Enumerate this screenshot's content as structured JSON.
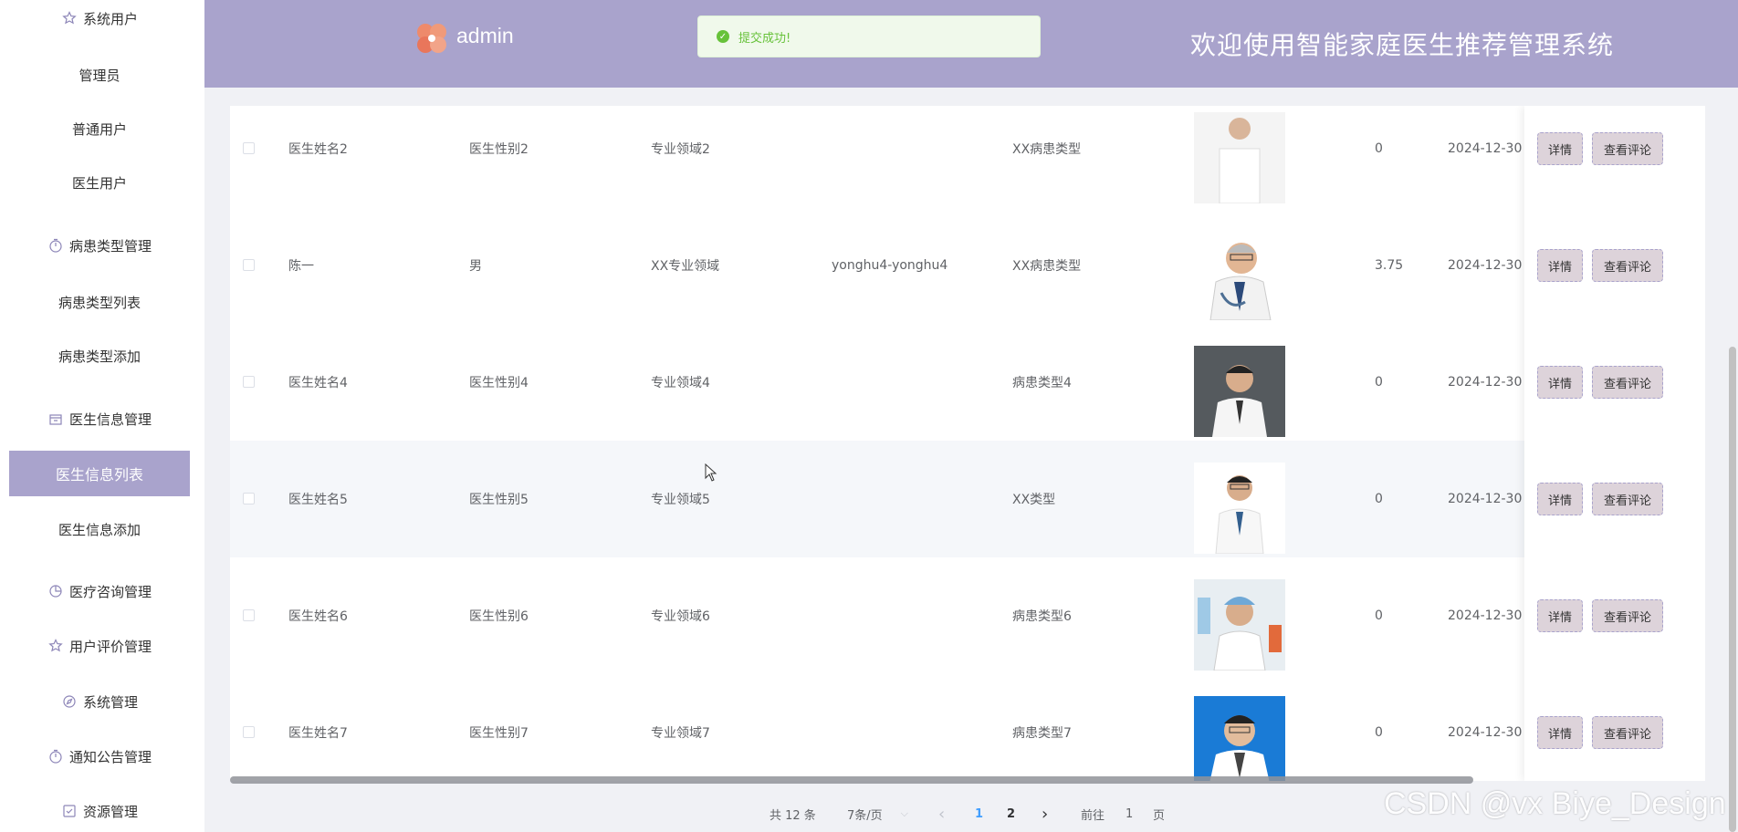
{
  "header": {
    "brand": "admin",
    "title": "欢迎使用智能家庭医生推荐管理系统",
    "toast": "提交成功!"
  },
  "sidebar": {
    "items": [
      {
        "label": "系统用户",
        "icon": "star-icon"
      },
      {
        "label": "管理员"
      },
      {
        "label": "普通用户"
      },
      {
        "label": "医生用户"
      },
      {
        "label": "病患类型管理",
        "icon": "timer-icon"
      },
      {
        "label": "病患类型列表"
      },
      {
        "label": "病患类型添加"
      },
      {
        "label": "医生信息管理",
        "icon": "box-icon"
      },
      {
        "label": "医生信息列表"
      },
      {
        "label": "医生信息添加"
      },
      {
        "label": "医疗咨询管理",
        "icon": "pie-icon"
      },
      {
        "label": "用户评价管理",
        "icon": "star-icon"
      },
      {
        "label": "系统管理",
        "icon": "compass-icon"
      },
      {
        "label": "通知公告管理",
        "icon": "timer-icon"
      },
      {
        "label": "资源管理",
        "icon": "check-icon"
      }
    ],
    "active_index": 8
  },
  "table": {
    "rows": [
      {
        "name": "医生姓名2",
        "gender": "医生性别2",
        "field": "专业领域2",
        "account": "",
        "disease": "XX病患类型",
        "score": "0",
        "date": "2024-12-30"
      },
      {
        "name": "陈一",
        "gender": "男",
        "field": "XX专业领域",
        "account": "yonghu4-yonghu4",
        "disease": "XX病患类型",
        "score": "3.75",
        "date": "2024-12-30"
      },
      {
        "name": "医生姓名4",
        "gender": "医生性别4",
        "field": "专业领域4",
        "account": "",
        "disease": "病患类型4",
        "score": "0",
        "date": "2024-12-30"
      },
      {
        "name": "医生姓名5",
        "gender": "医生性别5",
        "field": "专业领域5",
        "account": "",
        "disease": "XX类型",
        "score": "0",
        "date": "2024-12-30"
      },
      {
        "name": "医生姓名6",
        "gender": "医生性别6",
        "field": "专业领域6",
        "account": "",
        "disease": "病患类型6",
        "score": "0",
        "date": "2024-12-30"
      },
      {
        "name": "医生姓名7",
        "gender": "医生性别7",
        "field": "专业领域7",
        "account": "",
        "disease": "病患类型7",
        "score": "0",
        "date": "2024-12-30"
      }
    ],
    "detail_label": "详情",
    "comment_label": "查看评论"
  },
  "pagination": {
    "total": "共 12 条",
    "page_size": "7条/页",
    "pages": [
      "1",
      "2"
    ],
    "current": "1",
    "goto_prefix": "前往",
    "goto_value": "1",
    "goto_suffix": "页"
  },
  "watermark": "CSDN @vx Biye_Design",
  "colors": {
    "accent": "#a9a3cc",
    "button_bg": "#ddd3da",
    "success": "#67c23a"
  }
}
